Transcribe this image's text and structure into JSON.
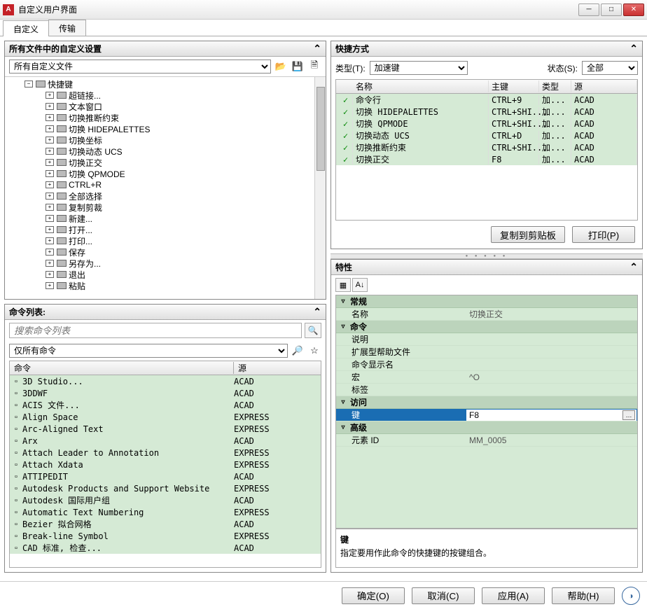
{
  "window": {
    "title": "自定义用户界面"
  },
  "tabs": [
    "自定义",
    "传输"
  ],
  "leftTop": {
    "title": "所有文件中的自定义设置",
    "filesDropdown": "所有自定义文件",
    "treeRoot": "快捷键",
    "treeItems": [
      "超链接...",
      "文本窗口",
      "切换推断约束",
      "切换 HIDEPALETTES",
      "切换坐标",
      "切换动态 UCS",
      "切换正交",
      "切换 QPMODE",
      "CTRL+R",
      "全部选择",
      "复制剪裁",
      "新建...",
      "打开...",
      "打印...",
      "保存",
      "另存为...",
      "退出",
      "粘贴"
    ]
  },
  "cmdList": {
    "title": "命令列表:",
    "searchPlaceholder": "搜索命令列表",
    "filter": "仅所有命令",
    "columns": [
      "命令",
      "源"
    ],
    "rows": [
      {
        "n": "3D Studio...",
        "s": "ACAD"
      },
      {
        "n": "3DDWF",
        "s": "ACAD"
      },
      {
        "n": "ACIS 文件...",
        "s": "ACAD"
      },
      {
        "n": "Align Space",
        "s": "EXPRESS"
      },
      {
        "n": "Arc-Aligned Text",
        "s": "EXPRESS"
      },
      {
        "n": "Arx",
        "s": "ACAD"
      },
      {
        "n": "Attach Leader to Annotation",
        "s": "EXPRESS"
      },
      {
        "n": "Attach Xdata",
        "s": "EXPRESS"
      },
      {
        "n": "ATTIPEDIT",
        "s": "ACAD"
      },
      {
        "n": "Autodesk Products and Support Website",
        "s": "EXPRESS"
      },
      {
        "n": "Autodesk 国际用户组",
        "s": "ACAD"
      },
      {
        "n": "Automatic Text Numbering",
        "s": "EXPRESS"
      },
      {
        "n": "Bezier 拟合网格",
        "s": "ACAD"
      },
      {
        "n": "Break-line Symbol",
        "s": "EXPRESS"
      },
      {
        "n": "CAD 标准, 检查...",
        "s": "ACAD"
      }
    ]
  },
  "shortcuts": {
    "title": "快捷方式",
    "typeLabel": "类型(T):",
    "typeValue": "加速键",
    "stateLabel": "状态(S):",
    "stateValue": "全部",
    "columns": [
      "名称",
      "主键",
      "类型",
      "源"
    ],
    "rows": [
      {
        "n": "命令行",
        "k": "CTRL+9",
        "t": "加...",
        "s": "ACAD"
      },
      {
        "n": "切换 HIDEPALETTES",
        "k": "CTRL+SHI...",
        "t": "加...",
        "s": "ACAD"
      },
      {
        "n": "切换 QPMODE",
        "k": "CTRL+SHI...",
        "t": "加...",
        "s": "ACAD"
      },
      {
        "n": "切换动态 UCS",
        "k": "CTRL+D",
        "t": "加...",
        "s": "ACAD"
      },
      {
        "n": "切换推断约束",
        "k": "CTRL+SHI...",
        "t": "加...",
        "s": "ACAD"
      },
      {
        "n": "切换正交",
        "k": "F8",
        "t": "加...",
        "s": "ACAD"
      }
    ],
    "copyBtn": "复制到剪贴板",
    "printBtn": "打印(P)"
  },
  "props": {
    "title": "特性",
    "groups": {
      "general": {
        "label": "常规",
        "rows": [
          {
            "l": "名称",
            "v": "切换正交"
          }
        ]
      },
      "command": {
        "label": "命令",
        "rows": [
          {
            "l": "说明",
            "v": ""
          },
          {
            "l": "扩展型帮助文件",
            "v": ""
          },
          {
            "l": "命令显示名",
            "v": ""
          },
          {
            "l": "宏",
            "v": "^O"
          },
          {
            "l": "标签",
            "v": ""
          }
        ]
      },
      "access": {
        "label": "访问",
        "rows": [
          {
            "l": "键",
            "v": "F8",
            "sel": true
          }
        ]
      },
      "advanced": {
        "label": "高级",
        "rows": [
          {
            "l": "元素 ID",
            "v": "MM_0005"
          }
        ]
      }
    },
    "descTitle": "键",
    "descText": "指定要用作此命令的快捷键的按键组合。"
  },
  "bottom": {
    "ok": "确定(O)",
    "cancel": "取消(C)",
    "apply": "应用(A)",
    "help": "帮助(H)"
  }
}
